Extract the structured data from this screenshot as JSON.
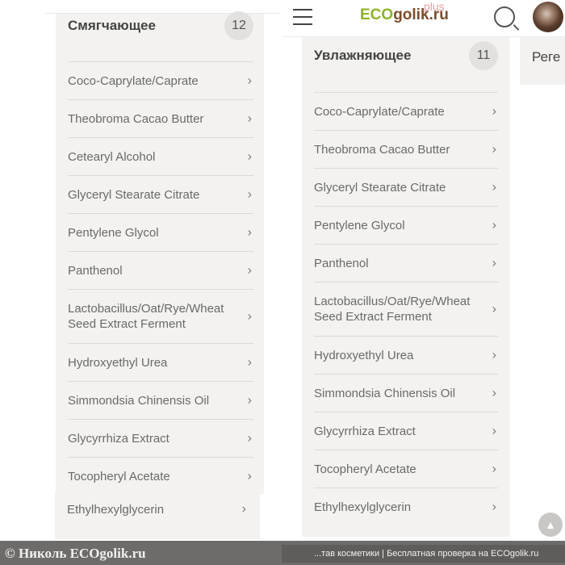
{
  "header": {
    "logo_eco": "ECO",
    "logo_golik": "golik.ru",
    "logo_plus": "plus"
  },
  "left_card": {
    "title": "Смягчающее",
    "count": "12",
    "items": [
      "Coco-Caprylate/Caprate",
      "Theobroma Cacao Butter",
      "Cetearyl Alcohol",
      "Glyceryl Stearate Citrate",
      "Pentylene Glycol",
      "Panthenol",
      "Lactobacillus/Oat/Rye/Wheat Seed Extract Ferment",
      "Hydroxyethyl Urea",
      "Simmondsia Chinensis Oil",
      "Glycyrrhiza Extract",
      "Tocopheryl Acetate"
    ],
    "extra_item": "Ethylhexylglycerin"
  },
  "right_card": {
    "title": "Увлажняющее",
    "count": "11",
    "items": [
      "Coco-Caprylate/Caprate",
      "Theobroma Cacao Butter",
      "Glyceryl Stearate Citrate",
      "Pentylene Glycol",
      "Panthenol",
      "Lactobacillus/Oat/Rye/Wheat Seed Extract Ferment",
      "Hydroxyethyl Urea",
      "Simmondsia Chinensis Oil",
      "Glycyrrhiza Extract",
      "Tocopheryl Acetate",
      "Ethylhexylglycerin"
    ]
  },
  "far_card": {
    "title": "Реге"
  },
  "footer": {
    "watermark": "© Николь ECOgolik.ru",
    "caption": "...тав косметики | Бесплатная проверка на ECOgolik.ru"
  },
  "icons": {
    "chevron": "chevron-right-icon",
    "scroll_top": "arrow-up-icon"
  }
}
